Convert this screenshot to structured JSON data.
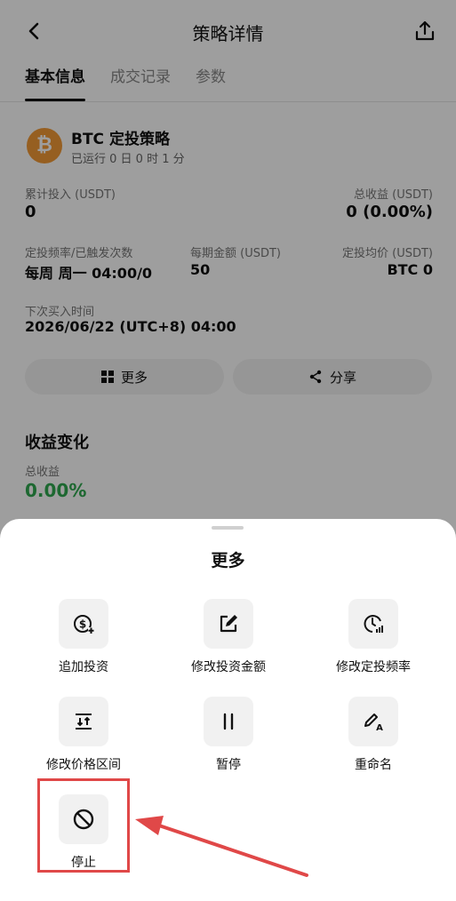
{
  "header": {
    "title": "策略详情",
    "back_icon": "chevron-left-icon",
    "share_icon": "upload-share-icon"
  },
  "tabs": [
    {
      "label": "基本信息",
      "active": true
    },
    {
      "label": "成交记录",
      "active": false
    },
    {
      "label": "参数",
      "active": false
    }
  ],
  "strategy": {
    "coin_symbol": "₿",
    "name": "BTC 定投策略",
    "runtime": "已运行 0 日 0 时 1 分"
  },
  "stats": {
    "total_invest_label": "累计投入 (USDT)",
    "total_invest_value": "0",
    "total_profit_label": "总收益 (USDT)",
    "total_profit_value": "0 (0.00%)",
    "freq_label": "定投频率/已触发次数",
    "freq_value": "每周 周一 04:00/0",
    "amount_label": "每期金额 (USDT)",
    "amount_value": "50",
    "avg_price_label": "定投均价 (USDT)",
    "avg_price_value": "BTC 0",
    "next_buy_label": "下次买入时间",
    "next_buy_value": "2026/06/22 (UTC+8) 04:00"
  },
  "buttons": {
    "more": "更多",
    "share": "分享"
  },
  "profit_section": {
    "title": "收益变化",
    "total_label": "总收益",
    "total_value": "0.00%"
  },
  "sheet": {
    "title": "更多",
    "items": [
      {
        "label": "追加投资",
        "icon": "dollar-plus-icon"
      },
      {
        "label": "修改投资金额",
        "icon": "edit-icon"
      },
      {
        "label": "修改定投频率",
        "icon": "clock-icon"
      },
      {
        "label": "修改价格区间",
        "icon": "range-icon"
      },
      {
        "label": "暂停",
        "icon": "pause-icon"
      },
      {
        "label": "重命名",
        "icon": "rename-pen-icon"
      },
      {
        "label": "停止",
        "icon": "stop-icon"
      }
    ]
  },
  "colors": {
    "accent_green": "#2fa84f",
    "coin_orange": "#f29a36",
    "highlight_red": "#e04848"
  }
}
